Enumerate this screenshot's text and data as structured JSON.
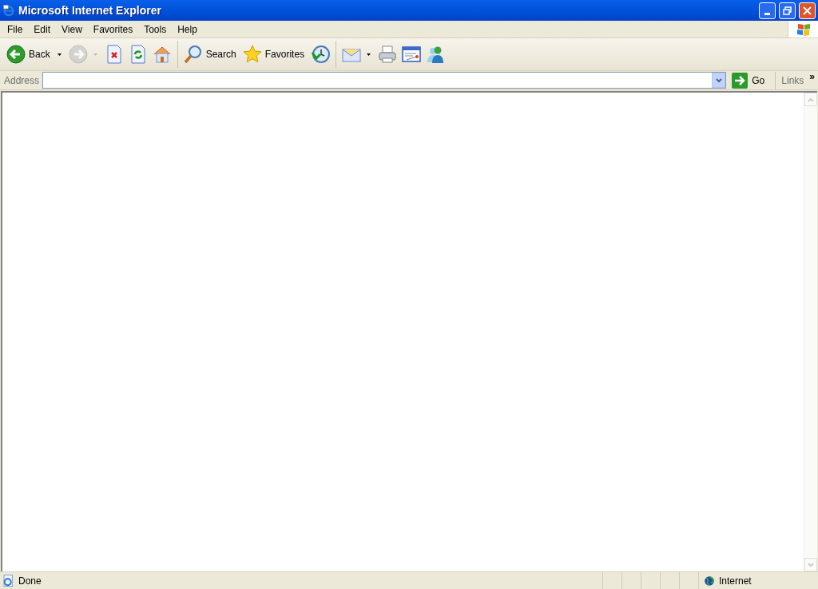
{
  "window": {
    "title": "Microsoft Internet Explorer"
  },
  "menu": [
    "File",
    "Edit",
    "View",
    "Favorites",
    "Tools",
    "Help"
  ],
  "toolbar": [
    {
      "kind": "button",
      "label": "Back",
      "disabled": false,
      "dropdown": true
    },
    {
      "kind": "button",
      "disabled": true,
      "dropdown": true
    },
    {
      "kind": "button",
      "disabled": false,
      "dropdown": false
    },
    {
      "kind": "button",
      "disabled": false,
      "dropdown": false
    },
    {
      "kind": "button",
      "disabled": false,
      "dropdown": false
    },
    {
      "kind": "separator"
    },
    {
      "kind": "button",
      "label": "Search",
      "disabled": false,
      "dropdown": false
    },
    {
      "kind": "button",
      "label": "Favorites",
      "disabled": false,
      "dropdown": false
    },
    {
      "kind": "button",
      "disabled": false,
      "dropdown": false
    },
    {
      "kind": "separator"
    },
    {
      "kind": "button",
      "disabled": false,
      "dropdown": true
    },
    {
      "kind": "button",
      "disabled": false,
      "dropdown": false
    },
    {
      "kind": "button",
      "disabled": false,
      "dropdown": false
    },
    {
      "kind": "button",
      "disabled": false,
      "dropdown": false
    }
  ],
  "address_bar": {
    "label": "Address",
    "go": "Go",
    "links": "Links",
    "more": "»"
  },
  "status_bar": {
    "text": "Done",
    "zone": "Internet"
  }
}
